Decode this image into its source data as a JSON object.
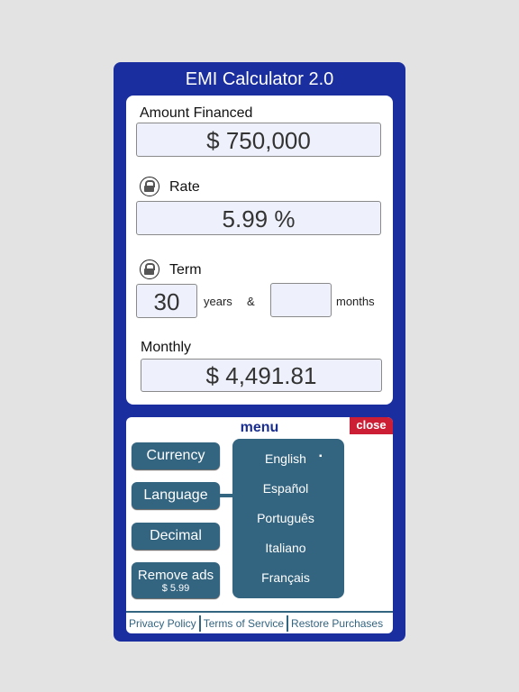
{
  "app": {
    "title": "EMI Calculator 2.0"
  },
  "calculator": {
    "amount_label": "Amount Financed",
    "amount_value": "$ 750,000",
    "rate_label": "Rate",
    "rate_value": "5.99 %",
    "term_label": "Term",
    "term_years": "30",
    "years_label": "years",
    "ampersand": "&",
    "term_months": "",
    "months_label": "months",
    "monthly_label": "Monthly",
    "monthly_value": "$ 4,491.81",
    "icons": {
      "rate_lock": "unlocked-padlock-icon",
      "term_lock": "unlocked-padlock-icon"
    }
  },
  "menu": {
    "title": "menu",
    "close_label": "close",
    "buttons": [
      {
        "label": "Currency"
      },
      {
        "label": "Language"
      },
      {
        "label": "Decimal"
      },
      {
        "label": "Remove ads",
        "sublabel": "$ 5.99"
      }
    ],
    "languages": [
      {
        "label": "English",
        "selected": true,
        "marker": "▪"
      },
      {
        "label": "Español"
      },
      {
        "label": "Português"
      },
      {
        "label": "Italiano"
      },
      {
        "label": "Français"
      }
    ],
    "colors": {
      "button": "#336480",
      "close": "#cc1f36",
      "frame": "#1a2ea0"
    }
  },
  "footer": {
    "links": [
      "Privacy Policy",
      "Terms of Service",
      "Restore Purchases"
    ]
  }
}
